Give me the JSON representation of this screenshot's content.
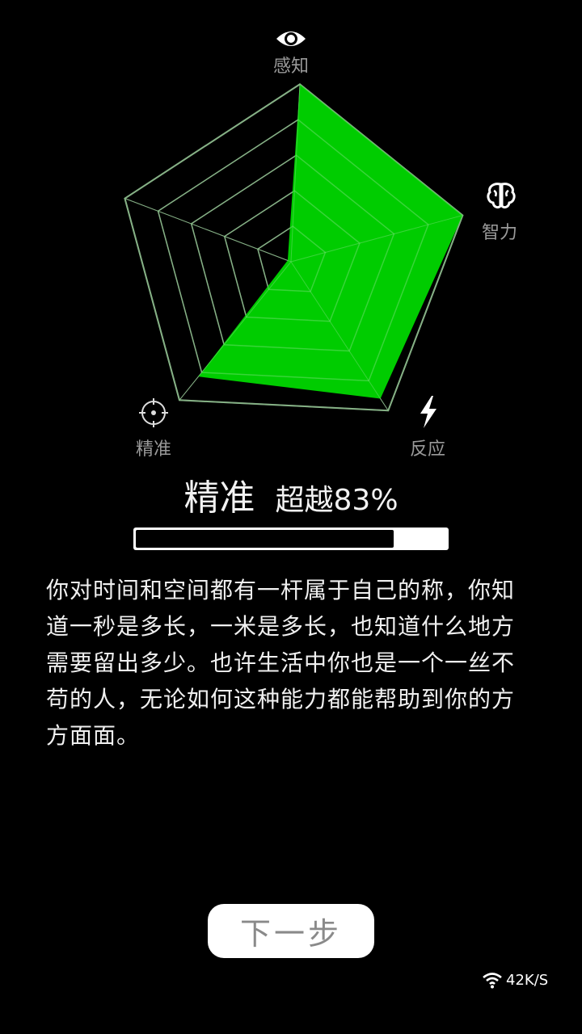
{
  "radar": {
    "axes": [
      {
        "label": "感知",
        "icon": "eye-icon",
        "value": 1.0
      },
      {
        "label": "智力",
        "icon": "brain-icon",
        "value": 1.0
      },
      {
        "label": "反应",
        "icon": "lightning-icon",
        "value": 0.92
      },
      {
        "label": "精准",
        "icon": "target-icon",
        "value": 0.83
      },
      {
        "label": "",
        "icon": "",
        "value": 0.02
      }
    ],
    "rings": 5,
    "fill_color": "#00cc00",
    "grid_color": "#8a8a8a"
  },
  "result": {
    "skill": "精准",
    "beat_text": "超越83%",
    "progress_fraction": 0.83
  },
  "description": "你对时间和空间都有一杆属于自己的称，你知道一秒是多长，一米是多长，也知道什么地方需要留出多少。也许生活中你也是一个一丝不苟的人，无论如何这种能力都能帮助到你的方方面面。",
  "next_button": {
    "label": "下一步"
  },
  "status": {
    "net_speed": "42K/S",
    "icon": "wifi-icon"
  }
}
